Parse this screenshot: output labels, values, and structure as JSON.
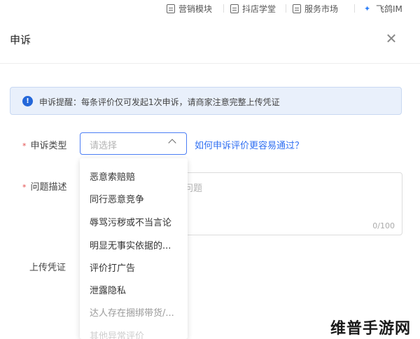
{
  "topnav": {
    "items": [
      {
        "label": "营销模块",
        "icon": "document-icon"
      },
      {
        "label": "抖店学堂",
        "icon": "document-icon"
      },
      {
        "label": "服务市场",
        "icon": "document-icon"
      },
      {
        "label": "飞鸽IM",
        "icon": "bird-icon"
      }
    ]
  },
  "dialog": {
    "title": "申诉",
    "close_icon": "close-icon"
  },
  "alert": {
    "icon": "info-icon",
    "text": "申诉提醒：每条评价仅可发起1次申诉，请商家注意完整上传凭证"
  },
  "form": {
    "required_mark": "*",
    "type_label": "申诉类型",
    "type_placeholder": "请选择",
    "help_link": "如何申诉评价更容易通过？",
    "desc_label": "问题描述",
    "desc_placeholder_fragment": "问题",
    "desc_counter": "0/100",
    "upload_label": "上传凭证"
  },
  "dropdown": {
    "options": [
      "恶意索赔赔",
      "同行恶意竞争",
      "辱骂污秽或不当言论",
      "明显无事实依据的...",
      "评价打广告",
      "泄露隐私",
      "达人存在捆绑带货/...",
      "其他异常评价"
    ]
  },
  "watermark": {
    "text": "维普手游网"
  }
}
